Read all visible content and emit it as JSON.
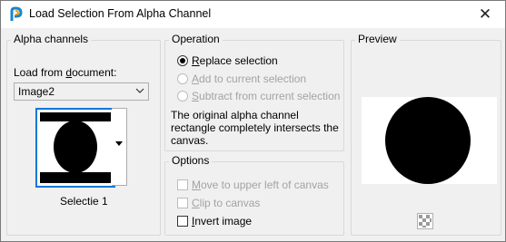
{
  "window": {
    "title": "Load Selection From Alpha Channel",
    "close_glyph": "✕"
  },
  "alpha_channels": {
    "group_title": "Alpha channels",
    "load_label_prefix": "Load from ",
    "load_label_accel": "d",
    "load_label_suffix": "ocument:",
    "document_selected": "Image2",
    "thumbnail_caption": "Selectie 1"
  },
  "operation": {
    "group_title": "Operation",
    "options": [
      {
        "accel": "R",
        "rest": "eplace selection",
        "checked": true,
        "enabled": true
      },
      {
        "accel": "A",
        "rest": "dd to current selection",
        "checked": false,
        "enabled": false
      },
      {
        "accel": "S",
        "rest": "ubtract from current selection",
        "checked": false,
        "enabled": false
      }
    ],
    "note_line1": "The original alpha channel",
    "note_line2": "rectangle completely intersects the",
    "note_line3": "canvas."
  },
  "options": {
    "group_title": "Options",
    "items": [
      {
        "accel": "M",
        "rest": "ove to upper left of canvas",
        "checked": false,
        "enabled": false
      },
      {
        "accel": "C",
        "rest": "lip to canvas",
        "checked": false,
        "enabled": false
      },
      {
        "accel": "I",
        "rest": "nvert image",
        "checked": false,
        "enabled": true
      }
    ]
  },
  "preview": {
    "group_title": "Preview"
  },
  "icons": {
    "app": "paint-shop-pro-icon",
    "close": "close-icon",
    "combo_arrow": "chevron-down-icon",
    "thumb_dropdown": "triangle-down-icon",
    "preview_toggle": "checkerboard-icon"
  }
}
